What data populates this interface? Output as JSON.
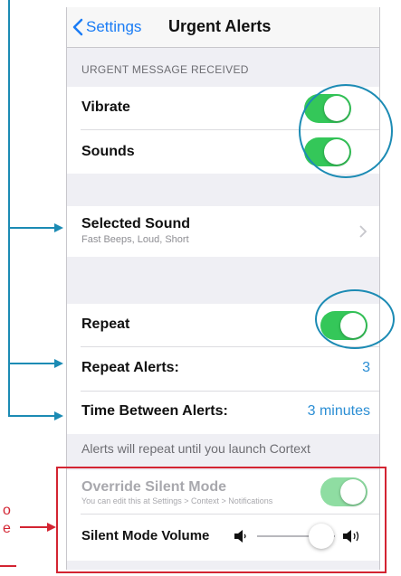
{
  "navbar": {
    "back_label": "Settings",
    "title": "Urgent Alerts"
  },
  "section_header": "URGENT MESSAGE RECEIVED",
  "vibrate": {
    "label": "Vibrate",
    "on": true
  },
  "sounds": {
    "label": "Sounds",
    "on": true
  },
  "selected_sound": {
    "label": "Selected Sound",
    "detail": "Fast Beeps, Loud, Short"
  },
  "repeat": {
    "label": "Repeat",
    "on": true
  },
  "repeat_alerts": {
    "label": "Repeat Alerts:",
    "value": "3"
  },
  "time_between": {
    "label": "Time Between Alerts:",
    "value": "3 minutes"
  },
  "repeat_footer": "Alerts will repeat until you launch Cortext",
  "override": {
    "label": "Override Silent Mode",
    "hint": "You can edit this at Settings > Context > Notifications",
    "on": true,
    "enabled": false
  },
  "silent_volume": {
    "label": "Silent Mode Volume",
    "level": 0.82
  },
  "annotation_fragments": [
    "o",
    "e"
  ],
  "colors": {
    "toggle_on": "#34c759",
    "accent_blue": "#1a7cf5",
    "annotation_blue": "#1c8bb4",
    "annotation_red": "#d32432"
  }
}
